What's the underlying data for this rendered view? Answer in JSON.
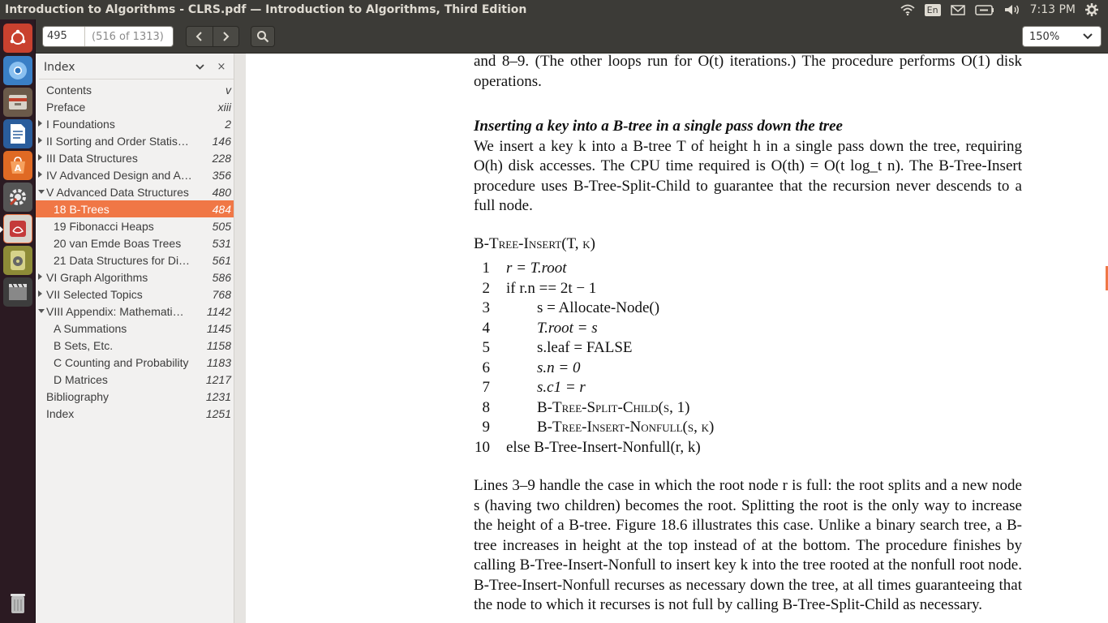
{
  "window": {
    "title": "Introduction to Algorithms - CLRS.pdf — Introduction to Algorithms, Third Edition"
  },
  "panel": {
    "language": "En",
    "time": "7:13 PM"
  },
  "launcher": {
    "apps": [
      "ubuntu-dash",
      "chromium",
      "files",
      "libreoffice-writer",
      "software-center",
      "system-settings",
      "document-viewer",
      "rhythmbox",
      "videos"
    ],
    "trash": "trash"
  },
  "toolbar": {
    "page_input": "495",
    "page_of": "(516 of 1313)",
    "zoom": "150%"
  },
  "sidebar": {
    "title": "Index",
    "close": "×",
    "items": [
      {
        "label": "Contents",
        "page": "v"
      },
      {
        "label": "Preface",
        "page": "xiii"
      },
      {
        "label": "I Foundations",
        "page": "2"
      },
      {
        "label": "II Sorting and Order Statis…",
        "page": "146"
      },
      {
        "label": "III Data Structures",
        "page": "228"
      },
      {
        "label": "IV Advanced Design and A…",
        "page": "356"
      },
      {
        "label": "V Advanced Data Structures",
        "page": "480"
      },
      {
        "label": "18 B-Trees",
        "page": "484"
      },
      {
        "label": "19 Fibonacci Heaps",
        "page": "505"
      },
      {
        "label": "20 van Emde Boas Trees",
        "page": "531"
      },
      {
        "label": "21 Data Structures for Di…",
        "page": "561"
      },
      {
        "label": "VI Graph Algorithms",
        "page": "586"
      },
      {
        "label": "VII Selected Topics",
        "page": "768"
      },
      {
        "label": "VIII Appendix: Mathemati…",
        "page": "1142"
      },
      {
        "label": "A Summations",
        "page": "1145"
      },
      {
        "label": "B Sets, Etc.",
        "page": "1158"
      },
      {
        "label": "C Counting and Probability",
        "page": "1183"
      },
      {
        "label": "D Matrices",
        "page": "1217"
      },
      {
        "label": "Bibliography",
        "page": "1231"
      },
      {
        "label": "Index",
        "page": "1251"
      }
    ]
  },
  "doc": {
    "para1": "and 8–9. (The other loops run for O(t) iterations.) The procedure performs O(1) disk operations.",
    "heading": "Inserting a key into a B-tree in a single pass down the tree",
    "para2": "We insert a key k into a B-tree T of height h in a single pass down the tree, requiring O(h) disk accesses. The CPU time required is O(th) = O(t log_t n). The B-Tree-Insert procedure uses B-Tree-Split-Child to guarantee that the recursion never descends to a full node.",
    "proc_title": "B-Tree-Insert(T, k)",
    "code": [
      {
        "n": "1",
        "text": "r = T.root"
      },
      {
        "n": "2",
        "text": "if r.n == 2t − 1"
      },
      {
        "n": "3",
        "text": "s = Allocate-Node()"
      },
      {
        "n": "4",
        "text": "T.root = s"
      },
      {
        "n": "5",
        "text": "s.leaf = FALSE"
      },
      {
        "n": "6",
        "text": "s.n = 0"
      },
      {
        "n": "7",
        "text": "s.c1 = r"
      },
      {
        "n": "8",
        "text": "B-Tree-Split-Child(s, 1)"
      },
      {
        "n": "9",
        "text": "B-Tree-Insert-Nonfull(s, k)"
      },
      {
        "n": "10",
        "text": "else B-Tree-Insert-Nonfull(r, k)"
      }
    ],
    "para3": "Lines 3–9 handle the case in which the root node r is full: the root splits and a new node s (having two children) becomes the root. Splitting the root is the only way to increase the height of a B-tree. Figure 18.6 illustrates this case. Unlike a binary search tree, a B-tree increases in height at the top instead of at the bottom. The procedure finishes by calling B-Tree-Insert-Nonfull to insert key k into the tree rooted at the nonfull root node. B-Tree-Insert-Nonfull recurses as necessary down the tree, at all times guaranteeing that the node to which it recurses is not full by calling B-Tree-Split-Child as necessary."
  },
  "colors": {
    "accent": "#f07746",
    "panel": "#3c3b37",
    "launcher": "#2b1a22",
    "sidebar": "#f2f1f0"
  }
}
